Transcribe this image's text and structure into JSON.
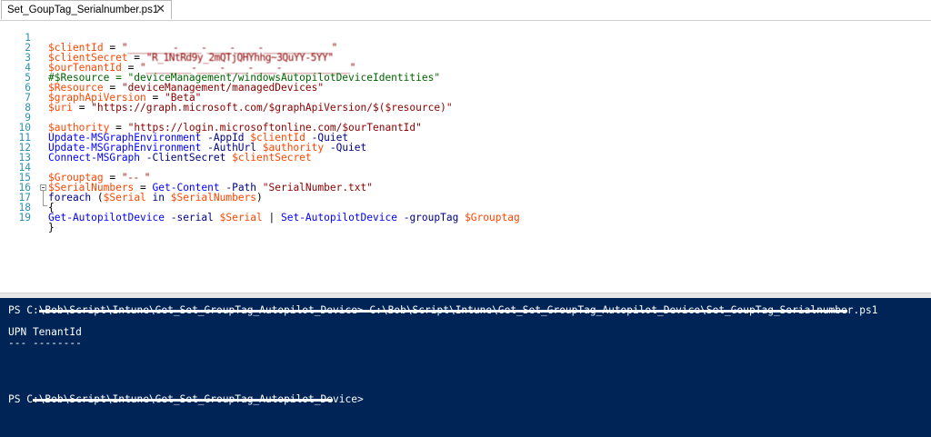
{
  "tab": {
    "title": "Set_GoupTag_Serialnumber.ps1",
    "close_icon": "✕"
  },
  "editor": {
    "lines": [
      {
        "num": "1",
        "var": "$clientId",
        "eq": " = ",
        "str": "\"________-____-____-____-____________\""
      },
      {
        "num": "2",
        "var": "$clientSecret",
        "eq": " = ",
        "str": "\"R_1NtRd9y_2mQTjQHYhhg~3QuYY-5YY\""
      },
      {
        "num": "3",
        "var": "$ourTenantId",
        "eq": " = ",
        "str": "\"________-____-____-____-____________\""
      },
      {
        "num": "4",
        "comment": "#$Resource = \"deviceManagement/windowsAutopilotDeviceIdentities\""
      },
      {
        "num": "5",
        "var": "$Resource",
        "eq": " = ",
        "str": "\"deviceManagement/managedDevices\""
      },
      {
        "num": "6",
        "var": "$graphApiVersion",
        "eq": " = ",
        "str": "\"Beta\""
      },
      {
        "num": "7",
        "var": "$uri",
        "eq": " = ",
        "str": "\"https://graph.microsoft.com/$graphApiVersion/$($resource)\""
      },
      {
        "num": "8"
      },
      {
        "num": "9",
        "var": "$authority",
        "eq": " = ",
        "str": "\"https://login.microsoftonline.com/$ourTenantId\""
      },
      {
        "num": "10",
        "cmd": "Update-MSGraphEnvironment",
        "p1": " -AppId ",
        "v1": "$clientId",
        "p2": " -Quiet"
      },
      {
        "num": "11",
        "cmd": "Update-MSGraphEnvironment",
        "p1": " -AuthUrl ",
        "v1": "$authority",
        "p2": " -Quiet"
      },
      {
        "num": "12",
        "cmd": "Connect-MSGraph",
        "p1": " -ClientSecret ",
        "v1": "$clientSecret",
        "p2": ""
      },
      {
        "num": "13"
      },
      {
        "num": "14",
        "var": "$Grouptag",
        "eq": " = ",
        "str": "\"‐‐ \""
      },
      {
        "num": "15",
        "var": "$SerialNumbers",
        "eq": " = ",
        "cmd": "Get-Content",
        "p1": " -Path ",
        "str2": "\"SerialNumber.txt\""
      },
      {
        "num": "16",
        "kw": "foreach",
        "rest1": " (",
        "v1": "$Serial",
        "kw2": " in ",
        "v2": "$SerialNumbers",
        "rest2": ")"
      },
      {
        "num": "17",
        "brace": "{"
      },
      {
        "num": "18",
        "cmd": "Get-AutopilotDevice",
        "p1": " -serial ",
        "v1": "$Serial",
        "pipe": " | ",
        "cmd2": "Set-AutopilotDevice",
        "p2": " -groupTag ",
        "v2": "$Grouptag"
      },
      {
        "num": "19",
        "brace": "}"
      }
    ]
  },
  "console": {
    "line1_prefix": "PS C:",
    "line1_redacted": "\\Bob\\Script\\Intune\\Get_Set_GroupTag_Autopilot_Device> C:\\Bob\\Script\\Intune\\Get_Set_GroupTag_Autopilot_Device\\Set_GoupTag_Serialnumbe",
    "line1_suffix": "r.ps1",
    "line2": "UPN TenantId",
    "line3": "--- --------",
    "line4_prefix": "PS C",
    "line4_redacted": ":\\Bob\\Script\\Intune\\Get_Set_GroupTag_Autopilot_De",
    "line4_suffix": "vice>"
  }
}
